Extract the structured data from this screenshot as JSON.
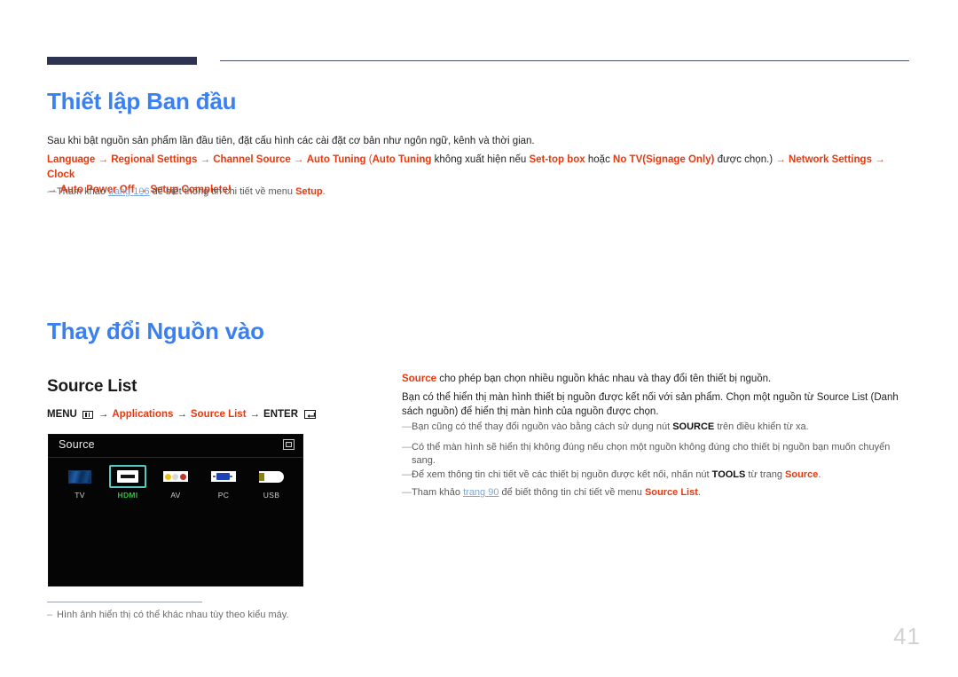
{
  "header": {
    "bar_color": "#2e3352",
    "line_color": "#4a4f6b"
  },
  "sections": [
    {
      "heading": "Thiết lập Ban đầu",
      "intro": "Sau khi bật nguồn sản phẩm lần đầu tiên, đặt cấu hình các cài đặt cơ bản như ngôn ngữ, kênh và thời gian.",
      "flow": {
        "l1_a": "Language",
        "arrow": "→",
        "l1_b": "Regional Settings",
        "l1_c": "Channel Source",
        "l1_d": "Auto Tuning",
        "l1_paren_open": "(",
        "l1_e": "Auto Tuning",
        "l1_text1": " không xuất hiện nếu ",
        "l1_f": "Set-top box",
        "l1_text2": " hoặc ",
        "l1_g": "No TV(Signage Only)",
        "l1_text3": " được chọn.)",
        "l1_h": "Network Settings",
        "l1_i": "Clock",
        "l2_a": "Auto Power Off",
        "l2_b": "Setup Complete!"
      },
      "note": {
        "dash": "—",
        "pre": "Tham khảo ",
        "link": "trang 106",
        "mid": " để biết thông tin chi tiết về menu ",
        "strong": "Setup",
        "post": "."
      }
    },
    {
      "heading": "Thay đổi Nguồn vào",
      "sub_heading": "Source List",
      "menu_path": {
        "menu": "MENU",
        "menu_icon": "menu-grid-icon",
        "arrow": "→",
        "item1": "Applications",
        "item2": "Source List",
        "enter": "ENTER",
        "enter_icon": "enter-return-icon"
      }
    }
  ],
  "source_panel": {
    "title": "Source",
    "corner_icon": "minimize-window-icon",
    "items": [
      {
        "id": "tv",
        "label": "TV",
        "icon": "tv-screen-icon",
        "selected": false
      },
      {
        "id": "hdmi",
        "label": "HDMI",
        "icon": "hdmi-connector-icon",
        "selected": true
      },
      {
        "id": "av",
        "label": "AV",
        "icon": "av-rca-jacks-icon",
        "selected": false
      },
      {
        "id": "pc",
        "label": "PC",
        "icon": "vga-connector-icon",
        "selected": false
      },
      {
        "id": "usb",
        "label": "USB",
        "icon": "usb-connector-icon",
        "selected": false
      }
    ],
    "selected_color": "#2fbf3e",
    "focus_border_color": "#55c9c2"
  },
  "caption_note": {
    "dash": "–",
    "text": "Hình ảnh hiển thị có thể khác nhau tùy theo kiểu máy."
  },
  "right_column": {
    "p1": {
      "strong": "Source",
      "text": " cho phép bạn chọn nhiều nguồn khác nhau và thay đổi tên thiết bị nguồn."
    },
    "p2": "Bạn có thể hiển thị màn hình thiết bị nguồn được kết nối với sản phẩm. Chọn một nguồn từ Source List (Danh sách nguồn) để hiển thị màn hình của nguồn được chọn.",
    "notes": [
      {
        "dash": "—",
        "pre": "Bạn cũng có thể thay đổi nguồn vào bằng cách sử dụng nút ",
        "strong": "SOURCE",
        "post": " trên điều khiển từ xa."
      },
      {
        "dash": "—",
        "pre": "Có thể màn hình sẽ hiển thị không đúng nếu chọn một nguồn không đúng cho thiết bị nguồn bạn muốn chuyển sang.",
        "strong": "",
        "post": ""
      },
      {
        "dash": "—",
        "pre": "Để xem thông tin chi tiết về các thiết bị nguồn được kết nối, nhấn nút ",
        "strong": "TOOLS",
        "mid": " từ trang ",
        "red": "Source",
        "post": "."
      },
      {
        "dash": "—",
        "pre": "Tham khảo ",
        "link": "trang 90",
        "mid": " để biết thông tin chi tiết về menu ",
        "red": "Source List",
        "post": "."
      }
    ]
  },
  "page_number": "41",
  "colors": {
    "heading_blue": "#3a80f2",
    "accent_red": "#e8380d",
    "link_blue": "#7ba7dd",
    "page_number_gray": "#d2d2d2"
  }
}
